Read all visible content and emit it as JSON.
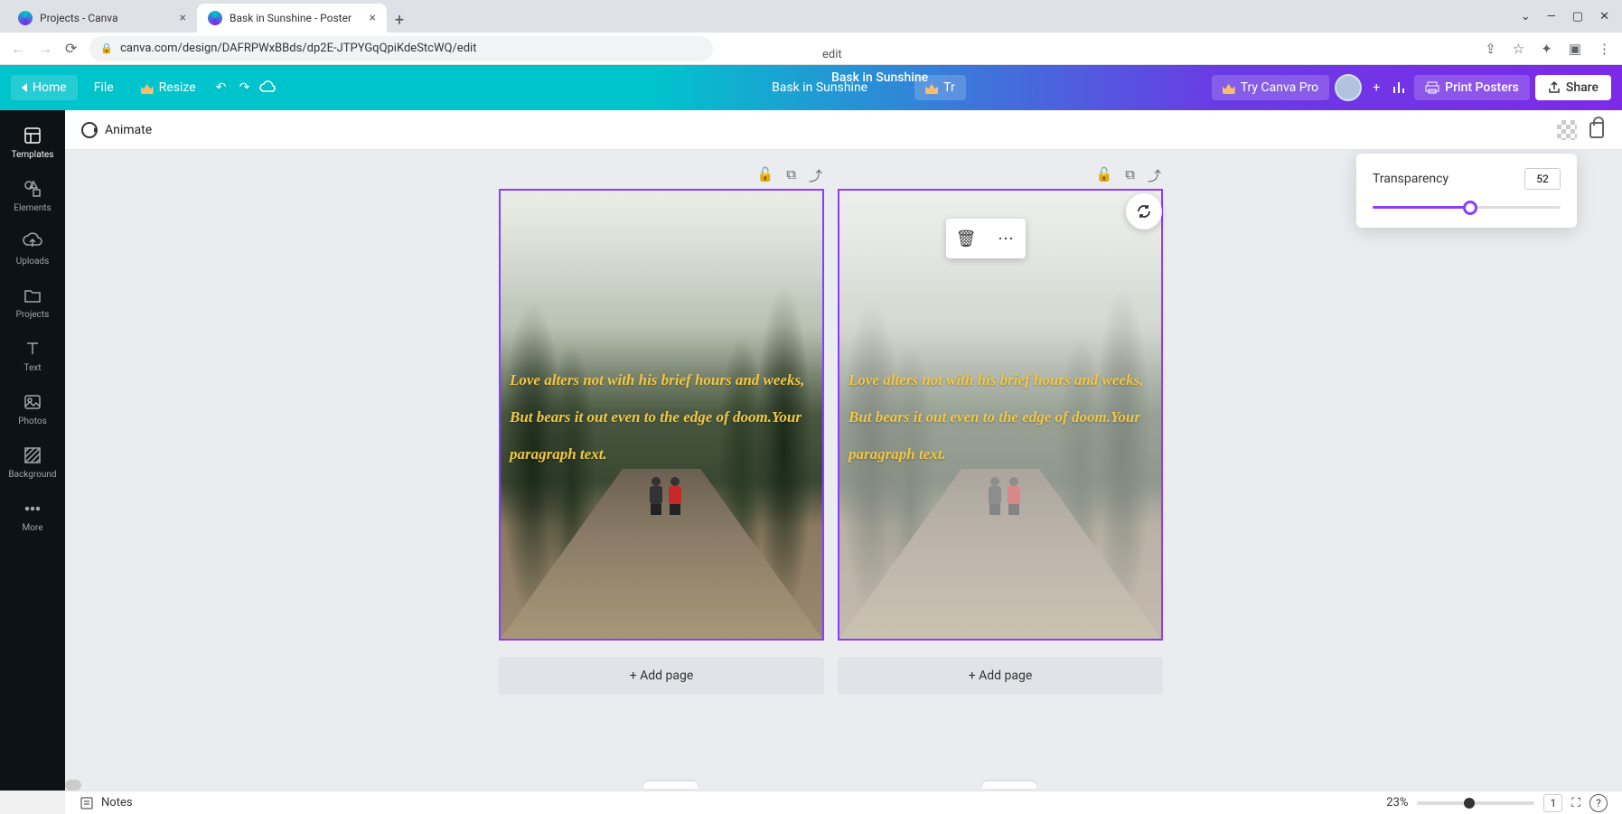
{
  "browser": {
    "tabs": [
      {
        "title": "Projects - Canva",
        "active": false
      },
      {
        "title": "Bask in Sunshine - Poster",
        "active": true
      }
    ],
    "url": "canva.com/design/DAFRPWxBBds/dp2E-JTPYGqQpiKdeStcWQ/edit",
    "url_suffix": "edit"
  },
  "topbar": {
    "home": "Home",
    "file": "File",
    "resize": "Resize",
    "doc_title": "Bask in Sunshine",
    "try_pro_short": "Tr",
    "try_pro": "Try Canva Pro",
    "print": "Print Posters",
    "share": "Share"
  },
  "context": {
    "animate": "Animate",
    "transparency_label": "Transparency",
    "transparency_value": "52"
  },
  "sidebar": {
    "items": [
      {
        "label": "Templates"
      },
      {
        "label": "Elements"
      },
      {
        "label": "Uploads"
      },
      {
        "label": "Projects"
      },
      {
        "label": "Text"
      },
      {
        "label": "Photos"
      },
      {
        "label": "Background"
      },
      {
        "label": "More"
      }
    ]
  },
  "pages": {
    "poem": "Love alters not with his brief hours and weeks,\nBut bears it out even to the edge of doom.Your paragraph text.",
    "add_page": "+ Add page"
  },
  "bottom": {
    "notes": "Notes",
    "zoom": "23%",
    "page_indicator": "1"
  }
}
